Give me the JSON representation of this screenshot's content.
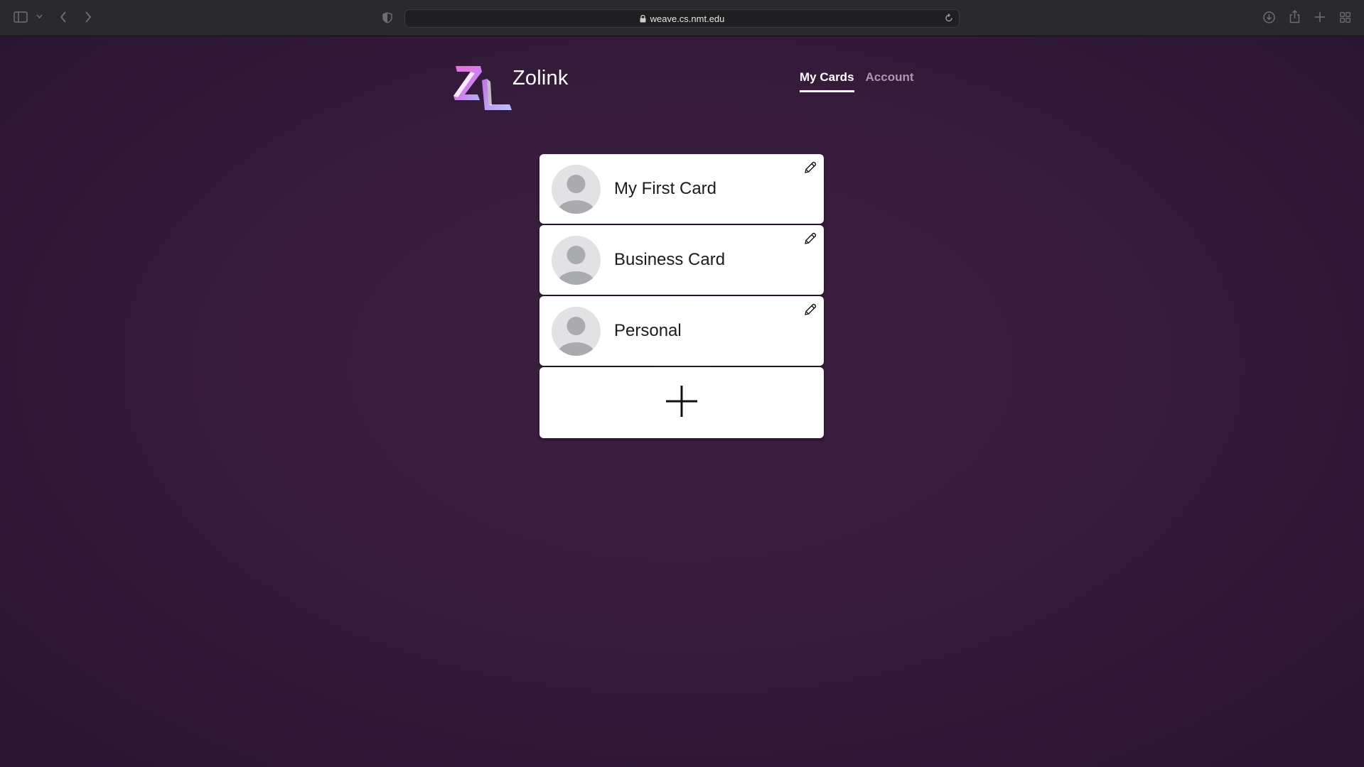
{
  "browser": {
    "url": "weave.cs.nmt.edu"
  },
  "header": {
    "brand_name": "Zolink",
    "nav": [
      {
        "label": "My Cards",
        "active": true
      },
      {
        "label": "Account",
        "active": false
      }
    ]
  },
  "cards": [
    {
      "title": "My First Card"
    },
    {
      "title": "Business Card"
    },
    {
      "title": "Personal"
    }
  ],
  "colors": {
    "page_background": "#371c3c",
    "card_background": "#ffffff",
    "nav_active": "#ffffff",
    "nav_inactive": "#a99aae",
    "logo_gradient_start": "#e05bd0",
    "logo_gradient_end": "#b49bf2"
  },
  "icons": {
    "sidebar": "sidebar-icon",
    "back": "chevron-left-icon",
    "forward": "chevron-right-icon",
    "shield": "shield-icon",
    "lock": "lock-icon",
    "reload": "reload-icon",
    "download": "download-icon",
    "share": "share-icon",
    "new_tab": "plus-icon",
    "tabs": "tab-overview-icon",
    "edit": "pencil-icon",
    "add_card": "plus-icon",
    "avatar": "person-icon"
  }
}
